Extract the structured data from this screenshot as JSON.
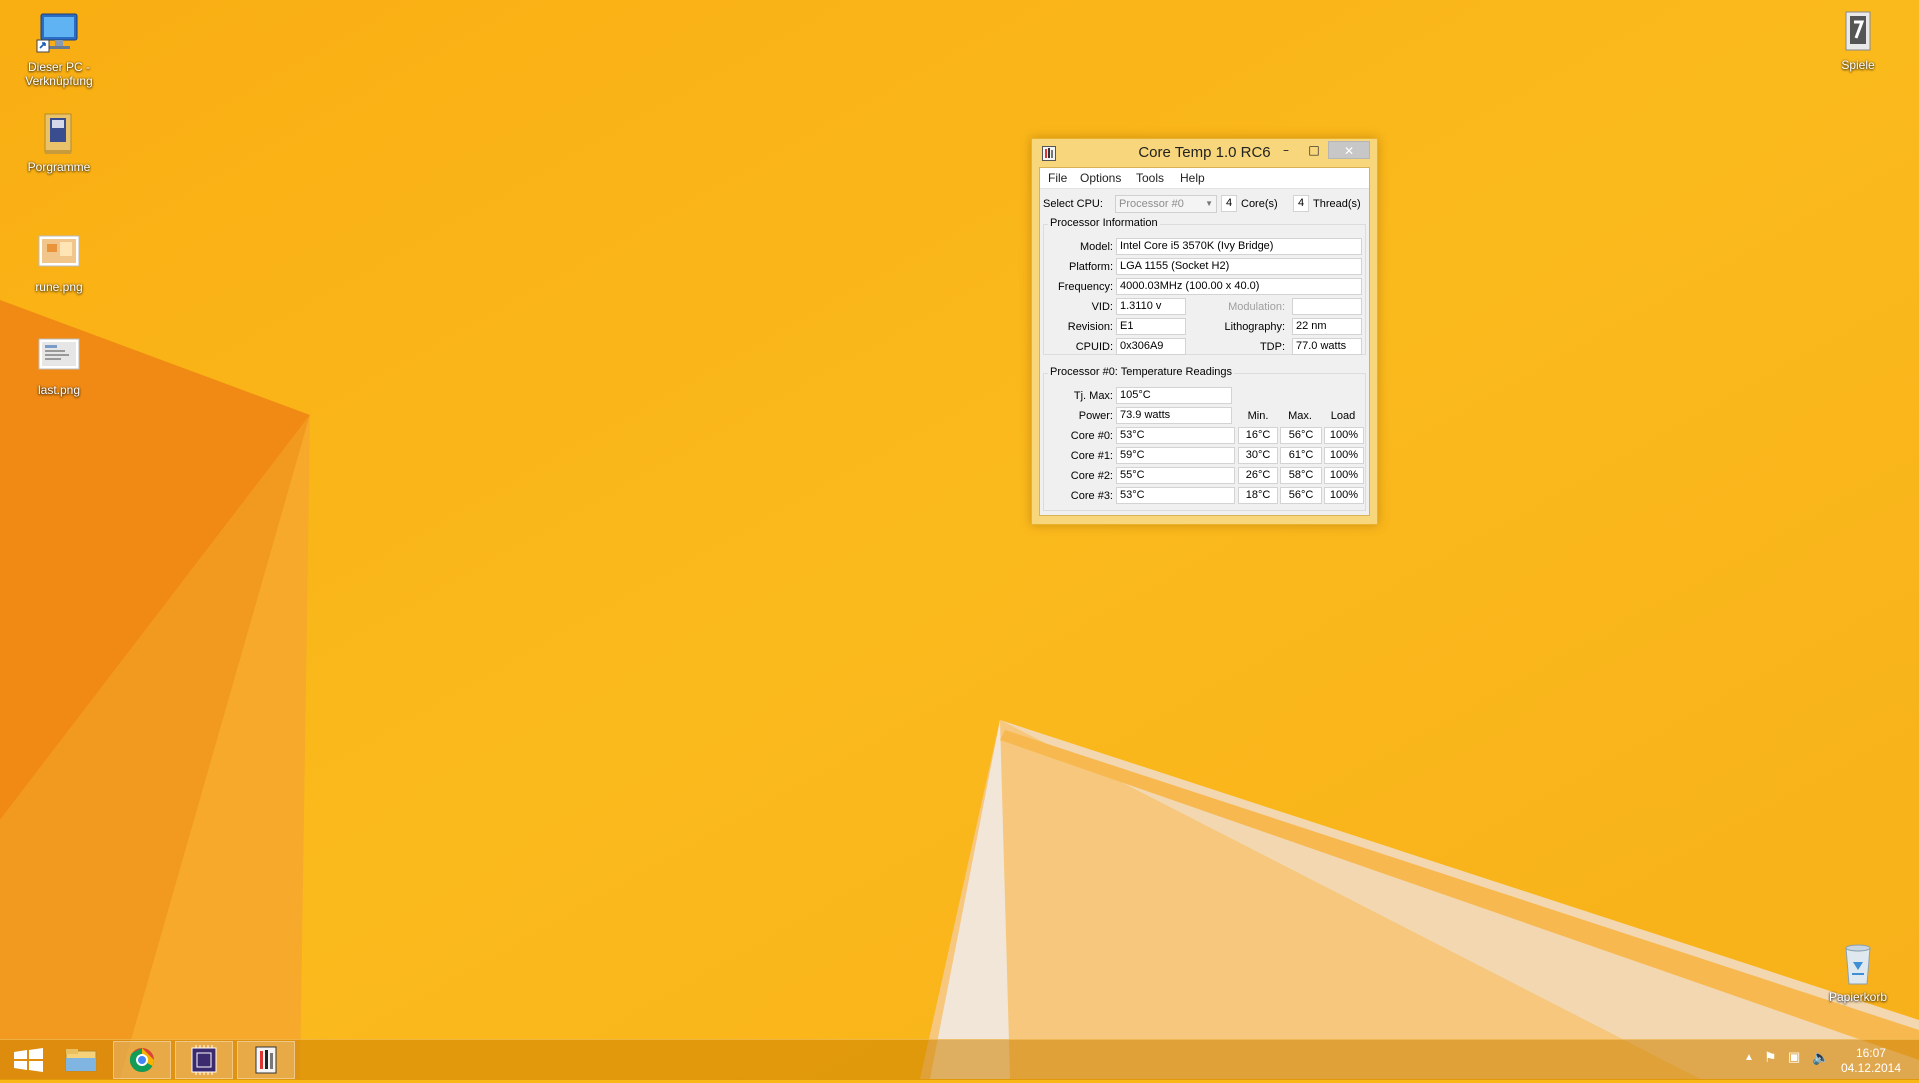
{
  "desktop": {
    "icons": [
      {
        "label": "Dieser PC - Verknüpfung",
        "icon": "computer-shortcut-icon"
      },
      {
        "label": "Porgramme",
        "icon": "folder-icon"
      },
      {
        "label": "rune.png",
        "icon": "image-file-icon"
      },
      {
        "label": "last.png",
        "icon": "image-file-icon"
      },
      {
        "label": "Spiele",
        "icon": "folder-icon"
      },
      {
        "label": "Papierkorb",
        "icon": "recycle-bin-icon"
      }
    ]
  },
  "window": {
    "title": "Core Temp 1.0 RC6",
    "menu": [
      "File",
      "Options",
      "Tools",
      "Help"
    ],
    "select_cpu_label": "Select CPU:",
    "cpu_select_value": "Processor #0",
    "cores_value": "4",
    "cores_label": "Core(s)",
    "threads_value": "4",
    "threads_label": "Thread(s)",
    "processor_info": {
      "title": "Processor Information",
      "model_label": "Model:",
      "model": "Intel Core i5 3570K (Ivy Bridge)",
      "platform_label": "Platform:",
      "platform": "LGA 1155 (Socket H2)",
      "frequency_label": "Frequency:",
      "frequency": "4000.03MHz (100.00 x 40.0)",
      "vid_label": "VID:",
      "vid": "1.3110 v",
      "modulation_label": "Modulation:",
      "modulation": "",
      "revision_label": "Revision:",
      "revision": "E1",
      "lithography_label": "Lithography:",
      "lithography": "22 nm",
      "cpuid_label": "CPUID:",
      "cpuid": "0x306A9",
      "tdp_label": "TDP:",
      "tdp": "77.0 watts"
    },
    "temps": {
      "title": "Processor #0: Temperature Readings",
      "tjmax_label": "Tj. Max:",
      "tjmax": "105°C",
      "power_label": "Power:",
      "power": "73.9 watts",
      "col_min": "Min.",
      "col_max": "Max.",
      "col_load": "Load",
      "cores": [
        {
          "label": "Core #0:",
          "temp": "53°C",
          "min": "16°C",
          "max": "56°C",
          "load": "100%"
        },
        {
          "label": "Core #1:",
          "temp": "59°C",
          "min": "30°C",
          "max": "61°C",
          "load": "100%"
        },
        {
          "label": "Core #2:",
          "temp": "55°C",
          "min": "26°C",
          "max": "58°C",
          "load": "100%"
        },
        {
          "label": "Core #3:",
          "temp": "53°C",
          "min": "18°C",
          "max": "56°C",
          "load": "100%"
        }
      ]
    }
  },
  "taskbar": {
    "buttons": [
      "start-icon",
      "file-explorer-icon",
      "chrome-icon",
      "cpu-app-icon",
      "core-temp-icon"
    ],
    "time": "16:07",
    "date": "04.12.2014"
  }
}
